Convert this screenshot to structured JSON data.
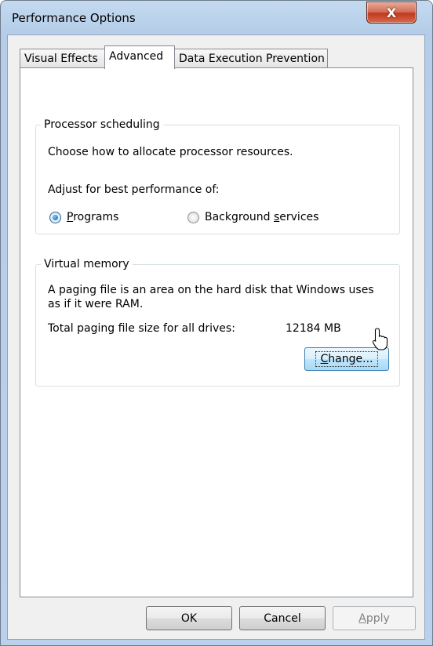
{
  "window": {
    "title": "Performance Options",
    "close_glyph": "X"
  },
  "tabs": [
    {
      "label": "Visual Effects",
      "active": false
    },
    {
      "label": "Advanced",
      "active": true
    },
    {
      "label": "Data Execution Prevention",
      "active": false
    }
  ],
  "processor_scheduling": {
    "legend": "Processor scheduling",
    "description": "Choose how to allocate processor resources.",
    "adjust_label": "Adjust for best performance of:",
    "options": [
      {
        "accel": "P",
        "rest": "rograms",
        "selected": true
      },
      {
        "pre": "Background ",
        "accel": "s",
        "rest": "ervices",
        "selected": false
      }
    ]
  },
  "virtual_memory": {
    "legend": "Virtual memory",
    "description_line1": "A paging file is an area on the hard disk that Windows uses",
    "description_line2": "as if it were RAM.",
    "total_label": "Total paging file size for all drives:",
    "total_value": "12184 MB",
    "change_accel": "C",
    "change_rest": "hange..."
  },
  "footer": {
    "ok_label": "OK",
    "cancel_label": "Cancel",
    "apply_accel": "A",
    "apply_rest": "pply"
  },
  "colors": {
    "frame": "#b9d1ea",
    "close_button": "#c0391f",
    "focus_button": "#bee6fd"
  },
  "icons": {
    "cursor": "mouse-pointer-icon"
  }
}
